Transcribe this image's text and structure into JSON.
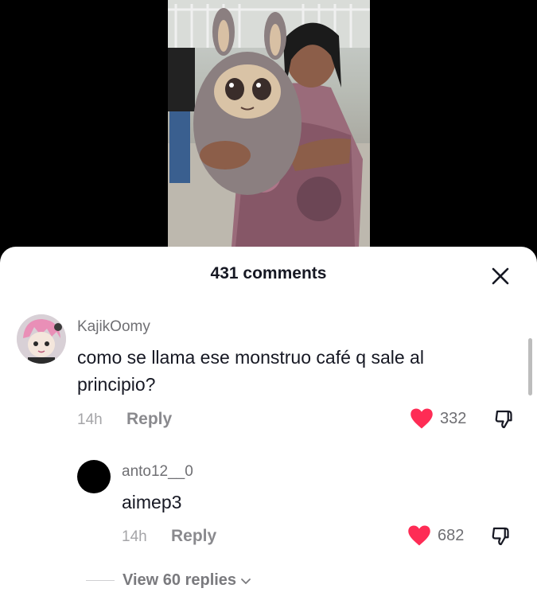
{
  "video": {
    "icon": "video-frame-woman-holding-plush-monster"
  },
  "header": {
    "comment_count": "431 comments",
    "close_icon": "close-icon"
  },
  "comments": [
    {
      "username": "KajikOomy",
      "text": "como se llama ese monstruo café q sale al principio?",
      "time": "14h",
      "reply_label": "Reply",
      "likes": "332",
      "liked": true,
      "avatar_icon": "anime-avatar-icon"
    }
  ],
  "replies": [
    {
      "username": "anto12__0",
      "text": "aimep3",
      "time": "14h",
      "reply_label": "Reply",
      "likes": "682",
      "liked": true,
      "avatar_icon": "black-circle-avatar-icon"
    }
  ],
  "view_replies": {
    "label": "View 60 replies",
    "icon": "chevron-down-icon"
  },
  "colors": {
    "heart": "#fe2c55",
    "sheet_bg": "#ffffff",
    "backdrop": "#000000"
  }
}
